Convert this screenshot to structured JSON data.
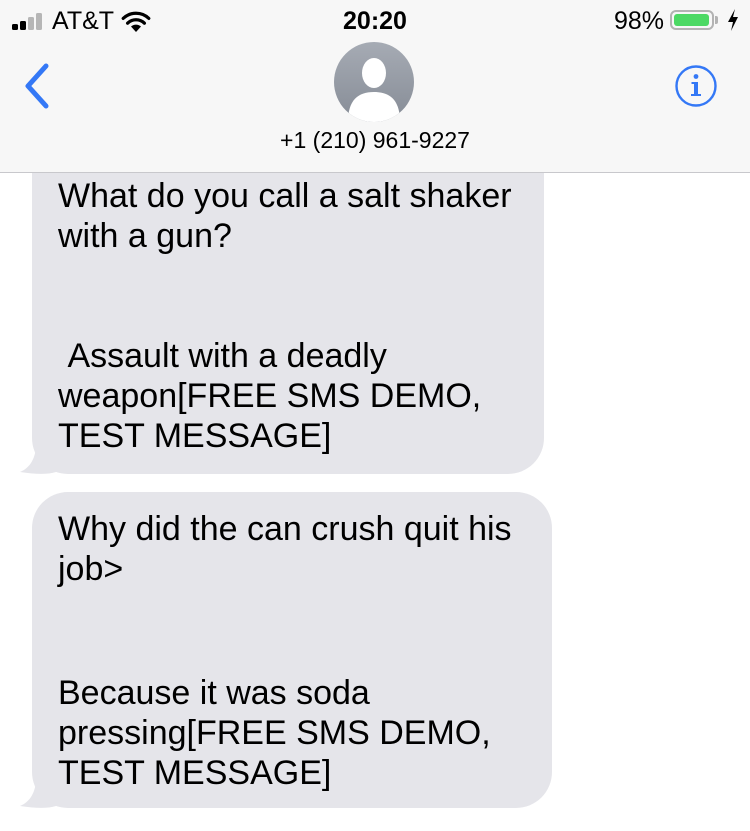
{
  "status_bar": {
    "carrier": "AT&T",
    "time": "20:20",
    "battery_percent": "98%",
    "battery_level": 0.98,
    "signal_bars_filled": 2,
    "signal_bars_total": 4,
    "charging": true
  },
  "header": {
    "back_icon": "chevron-left-icon",
    "contact": "+1 (210) 961-9227",
    "info_icon": "info-icon",
    "accent_color": "#3478f6"
  },
  "messages": [
    {
      "direction": "incoming",
      "question": "What do you call a salt shaker\nwith a gun?",
      "answer": " Assault with a deadly\nweapon[FREE SMS DEMO,\nTEST MESSAGE]"
    },
    {
      "direction": "incoming",
      "question": "Why did the can crush quit his\njob>",
      "answer": "Because it was soda\npressing[FREE SMS DEMO,\nTEST MESSAGE]"
    }
  ],
  "colors": {
    "incoming_bubble": "#e5e5ea",
    "header_background": "#f7f7f7",
    "battery_fill": "#4cd964"
  }
}
